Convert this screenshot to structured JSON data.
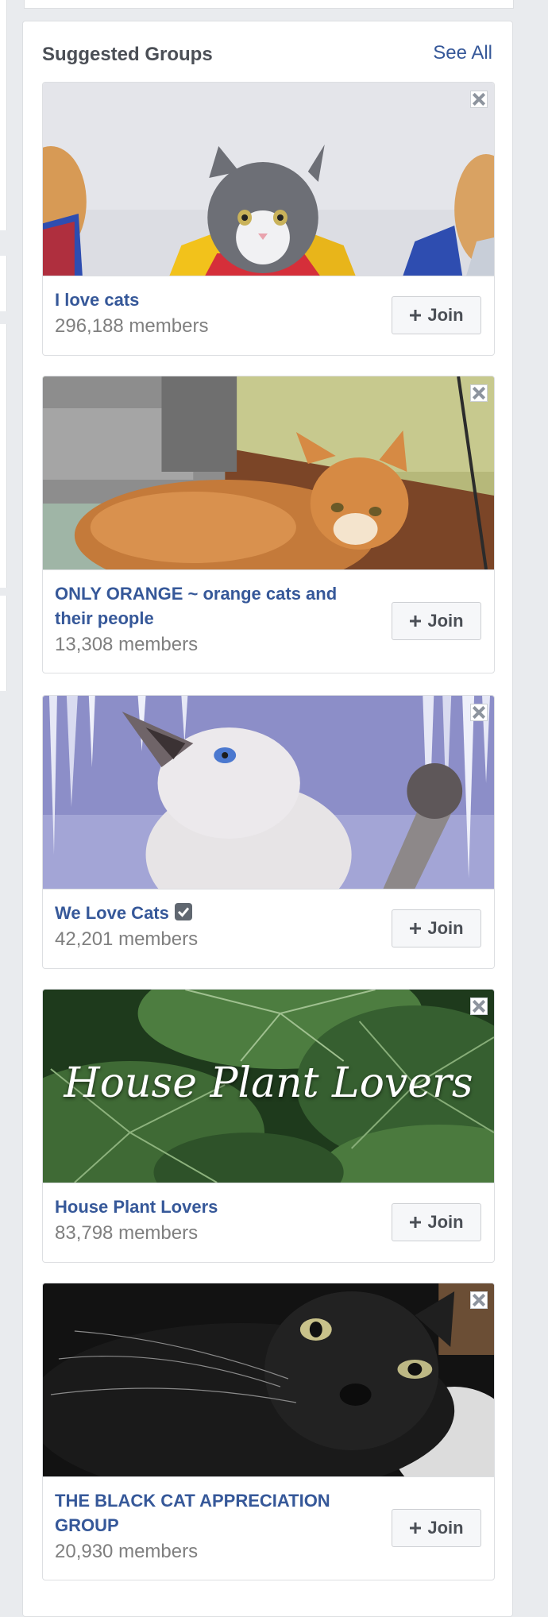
{
  "panel": {
    "title": "Suggested Groups",
    "see_all_label": "See All"
  },
  "groups": [
    {
      "name": "I love cats",
      "members": "296,188 members",
      "join_label": "Join",
      "cover_icon": "cats-in-capes-photo",
      "verified": false
    },
    {
      "name": "ONLY ORANGE ~ orange cats and their people",
      "members": "13,308 members",
      "join_label": "Join",
      "cover_icon": "orange-cat-photo",
      "verified": false
    },
    {
      "name": "We Love Cats",
      "members": "42,201 members",
      "join_label": "Join",
      "cover_icon": "siamese-cat-icicles-photo",
      "verified": true
    },
    {
      "name": "House Plant Lovers",
      "members": "83,798 members",
      "join_label": "Join",
      "cover_icon": "house-plant-leaves-photo",
      "cover_text": "House Plant Lovers",
      "verified": false
    },
    {
      "name": "THE BLACK CAT APPRECIATION GROUP",
      "members": "20,930 members",
      "join_label": "Join",
      "cover_icon": "black-cat-photo",
      "verified": false
    }
  ],
  "colors": {
    "link": "#365899",
    "title": "#4b4f56",
    "muted": "#7f7f7f",
    "page_bg": "#e9ebee"
  }
}
